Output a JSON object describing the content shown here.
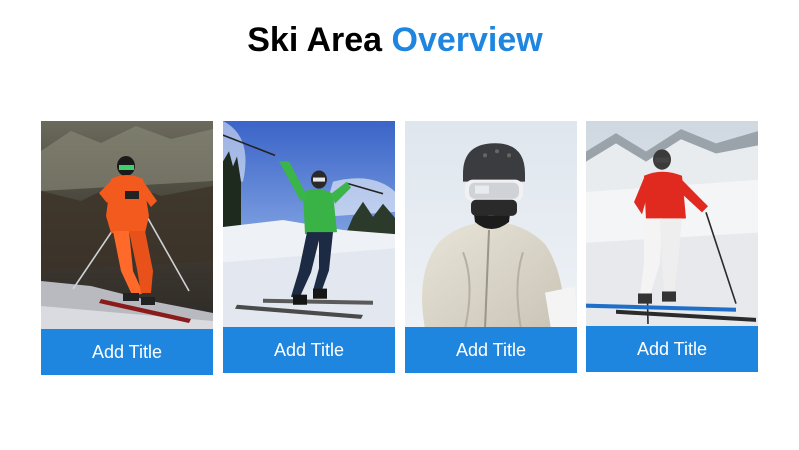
{
  "slide": {
    "title_main": "Ski Area",
    "title_accent": "Overview",
    "accent_color": "#1f86e0"
  },
  "cards": [
    {
      "caption": "Add Title",
      "photo": "skier-orange-suit-photo"
    },
    {
      "caption": "Add Title",
      "photo": "skier-green-jacket-photo"
    },
    {
      "caption": "Add Title",
      "photo": "skier-white-jacket-helmet-photo"
    },
    {
      "caption": "Add Title",
      "photo": "skier-red-jacket-photo"
    }
  ]
}
